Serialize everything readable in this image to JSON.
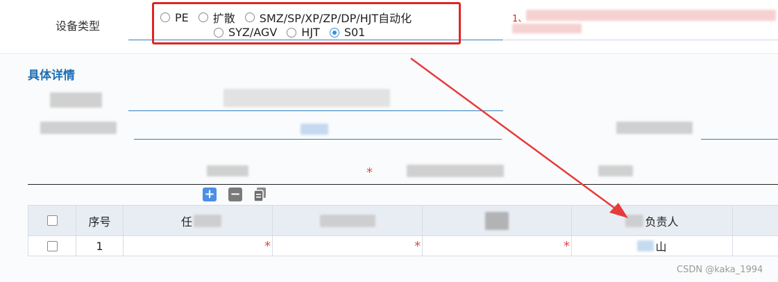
{
  "form": {
    "device_type_label": "设备类型",
    "radio_options_row1": [
      "PE",
      "扩散",
      "SMZ/SP/XP/ZP/DP/HJT自动化"
    ],
    "radio_options_row2": [
      "SYZ/AGV",
      "HJT",
      "S01"
    ],
    "selected_option": "S01",
    "note_text": "1、"
  },
  "section": {
    "title": "具体详情"
  },
  "table": {
    "headers": {
      "seq": "序号",
      "col2_visible": "任",
      "owner_visible": "负责人"
    },
    "rows": [
      {
        "seq": "1",
        "owner_visible": "山"
      }
    ]
  },
  "colors": {
    "accent": "#1d6fb5",
    "annotation": "#e02424",
    "required": "#e54545",
    "radio_checked": "#3b91d6",
    "header_bg": "#e8edf4"
  },
  "icons": [
    "radio-icon",
    "add-icon",
    "minus-icon",
    "copy-icon",
    "arrow-annotation-icon"
  ],
  "watermark": "CSDN @kaka_1994"
}
